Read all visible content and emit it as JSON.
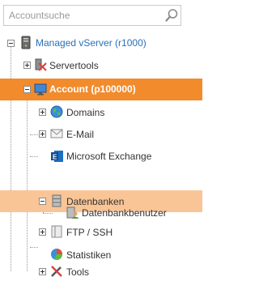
{
  "search": {
    "placeholder": "Accountsuche"
  },
  "tree": {
    "root": {
      "label": "Managed vServer (r1000)",
      "icon": "server-icon"
    },
    "servertools": {
      "label": "Servertools",
      "icon": "servertools-icon"
    },
    "account": {
      "label": "Account (p100000)",
      "icon": "monitor-icon"
    },
    "domains": {
      "label": "Domains",
      "icon": "globe-icon"
    },
    "email": {
      "label": "E-Mail",
      "icon": "envelope-icon"
    },
    "exchange": {
      "label": "Microsoft Exchange",
      "icon": "exchange-icon"
    },
    "datenbanken": {
      "label": "Datenbanken",
      "icon": "database-icon"
    },
    "dbuser": {
      "label": "Datenbankbenutzer",
      "icon": "database-user-icon"
    },
    "ftp": {
      "label": "FTP / SSH",
      "icon": "ftp-icon"
    },
    "stats": {
      "label": "Statistiken",
      "icon": "pie-chart-icon"
    },
    "tools": {
      "label": "Tools",
      "icon": "tools-icon"
    }
  },
  "colors": {
    "active": "#f28b2c",
    "hover": "#f9c596",
    "link": "#2a6fb7"
  }
}
